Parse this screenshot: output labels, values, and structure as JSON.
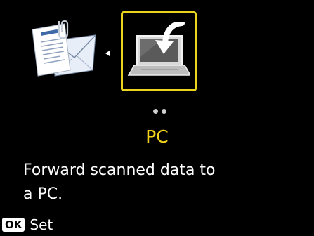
{
  "options": [
    {
      "name": "Attach to E-mail",
      "icon": "email-attachment-icon",
      "selected": false
    },
    {
      "name": "PC",
      "icon": "laptop-download-icon",
      "selected": true
    }
  ],
  "pager": {
    "dots": 2
  },
  "selected_title": "PC",
  "description_line1": "Forward scanned data to",
  "description_line2": "a PC.",
  "footer": {
    "key_label": "OK",
    "action_label": "Set"
  },
  "colors": {
    "background": "#000000",
    "accent": "#e8d51d",
    "title": "#f3d41b",
    "text": "#ffffff"
  }
}
